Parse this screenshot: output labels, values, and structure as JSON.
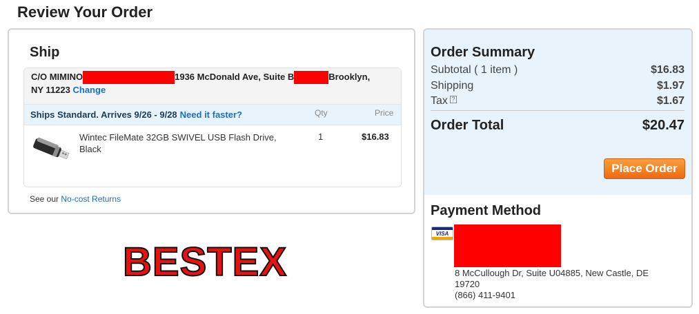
{
  "page": {
    "title": "Review Your Order"
  },
  "ship": {
    "title": "Ship",
    "address_name": "C/O MIMINO",
    "address_line": "1936 McDonald Ave, Suite B",
    "address_city": "Brooklyn,",
    "address_state_zip": "NY 11223",
    "change_label": "Change",
    "method": "Ships Standard. Arrives 9/26 - 9/28",
    "need_faster_label": "Need it faster?",
    "col_qty": "Qty",
    "col_price": "Price",
    "items": [
      {
        "name": "Wintec FileMate 32GB SWIVEL USB Flash Drive, Black",
        "qty": "1",
        "price": "$16.83"
      }
    ],
    "returns_prefix": "See our",
    "returns_link": "No-cost Returns"
  },
  "watermark": "BESTEX",
  "summary": {
    "title": "Order Summary",
    "subtotal_label": "Subtotal ( 1 item )",
    "subtotal_value": "$16.83",
    "shipping_label": "Shipping",
    "shipping_value": "$1.97",
    "tax_label": "Tax",
    "tax_help": "?",
    "tax_value": "$1.67",
    "total_label": "Order Total",
    "total_value": "$20.47",
    "place_order_label": "Place Order"
  },
  "payment": {
    "title": "Payment Method",
    "card_brand": "VISA",
    "address_line1": "8 McCullough Dr, Suite U04885, New Castle, DE",
    "address_line2": "19720",
    "phone": "(866) 411-9401"
  },
  "colors": {
    "link": "#1a6fc4",
    "place_order": "#ec6a14",
    "summary_bg": "#e8f3fb",
    "redaction": "#ff0000"
  }
}
